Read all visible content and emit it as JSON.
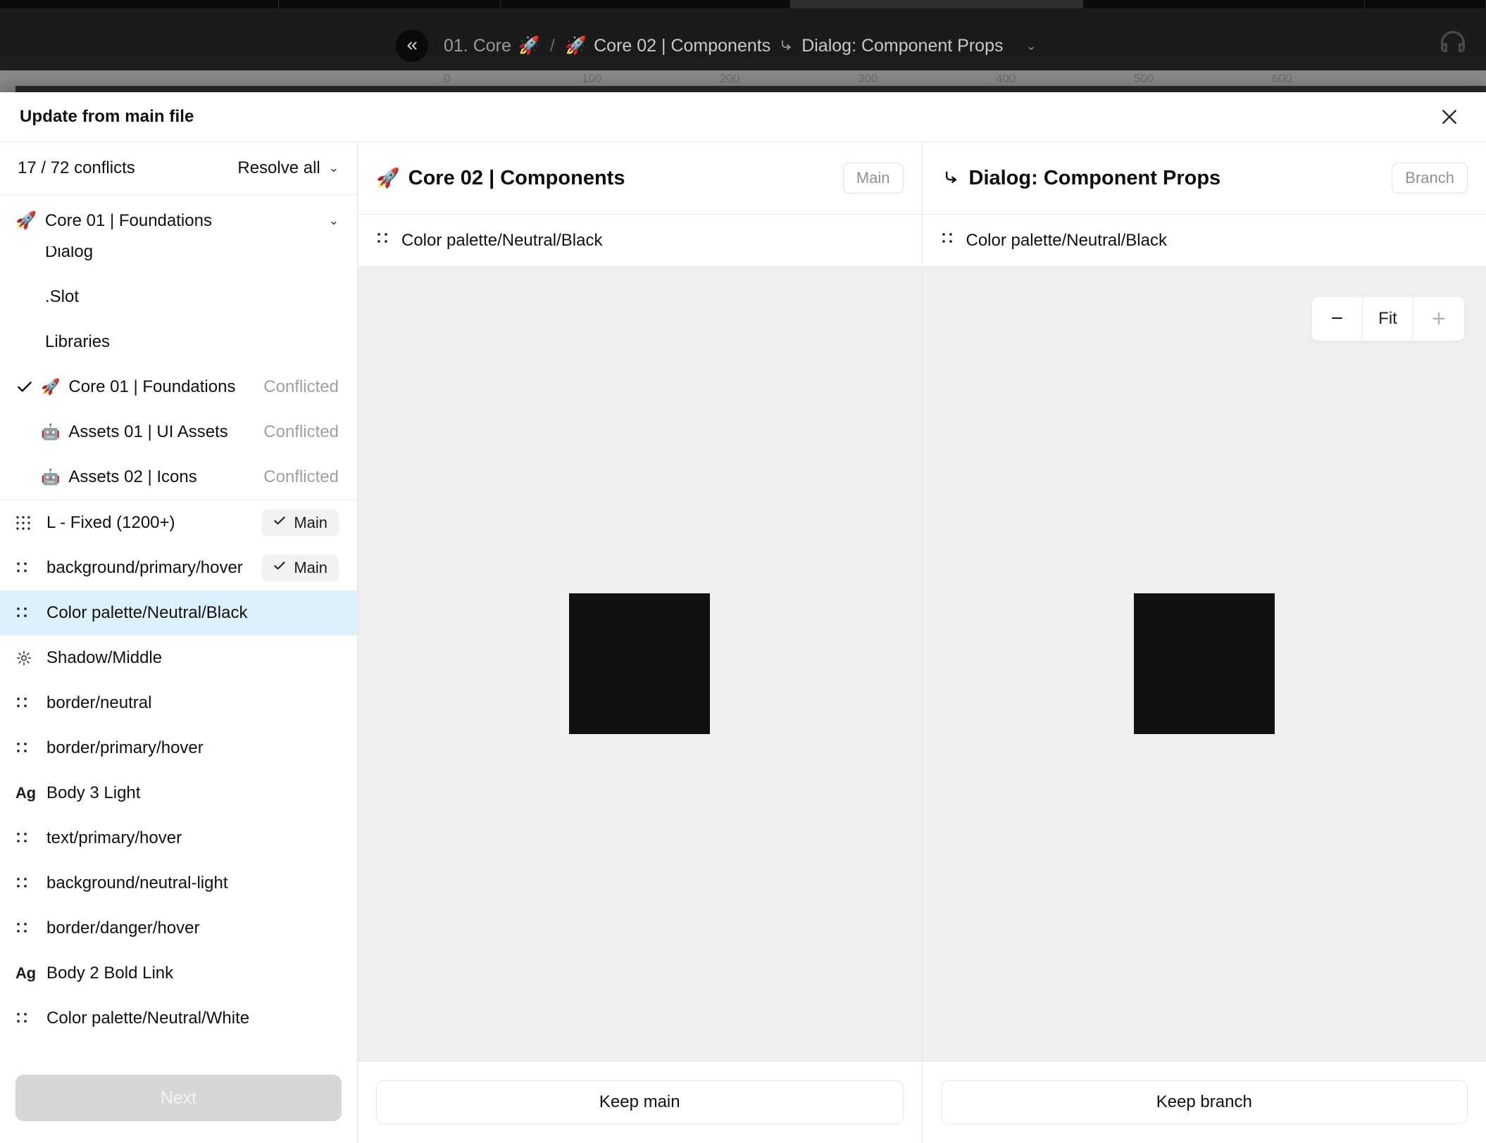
{
  "app": {
    "breadcrumb": {
      "collapse_icon": "chevrons-left-icon",
      "item1": "01. Core",
      "item1_emoji": "🚀",
      "separator": "/",
      "item2_emoji": "🚀",
      "item2": "Core 02 | Components",
      "branch_icon": "branch-icon",
      "item3": "Dialog: Component Props",
      "chevron": "chevron-down-icon",
      "headphones_icon": "headphones-icon"
    },
    "ruler": {
      "ticks": [
        "0",
        "100",
        "200",
        "300",
        "400",
        "500",
        "600"
      ]
    }
  },
  "modal": {
    "title": "Update from main file",
    "close_icon": "close-icon"
  },
  "sidebar": {
    "conflicts_label": "17 / 72 conflicts",
    "resolve_all_label": "Resolve all",
    "resolve_all_chevron": "chevron-down-icon",
    "group": {
      "emoji": "🚀",
      "label": "Core 01 | Foundations",
      "chevron": "chevron-down-icon"
    },
    "top_items": [
      {
        "label": "Dialog",
        "clipped": true
      },
      {
        "label": ".Slot"
      },
      {
        "label": "Libraries"
      }
    ],
    "library_items": [
      {
        "checked": true,
        "emoji": "🚀",
        "label": "Core 01 | Foundations",
        "status": "Conflicted"
      },
      {
        "checked": false,
        "emoji": "🤖",
        "label": "Assets 01 | UI Assets",
        "status": "Conflicted"
      },
      {
        "checked": false,
        "emoji": "🤖",
        "label": "Assets 02 | Icons",
        "status": "Conflicted"
      }
    ],
    "token_items": [
      {
        "icon": "grid-icon",
        "label": "L - Fixed (1200+)",
        "badge": "Main",
        "badge_check": "check-icon",
        "selected": false
      },
      {
        "icon": "variable-icon",
        "label": "background/primary/hover",
        "badge": "Main",
        "badge_check": "check-icon",
        "selected": false
      },
      {
        "icon": "variable-icon",
        "label": "Color palette/Neutral/Black",
        "badge": "",
        "selected": true
      },
      {
        "icon": "effect-icon",
        "label": "Shadow/Middle",
        "badge": "",
        "selected": false
      },
      {
        "icon": "variable-icon",
        "label": "border/neutral",
        "badge": "",
        "selected": false
      },
      {
        "icon": "variable-icon",
        "label": "border/primary/hover",
        "badge": "",
        "selected": false
      },
      {
        "icon": "text-style-icon",
        "label": "Body 3 Light",
        "badge": "",
        "selected": false
      },
      {
        "icon": "variable-icon",
        "label": "text/primary/hover",
        "badge": "",
        "selected": false
      },
      {
        "icon": "variable-icon",
        "label": "background/neutral-light",
        "badge": "",
        "selected": false
      },
      {
        "icon": "variable-icon",
        "label": "border/danger/hover",
        "badge": "",
        "selected": false
      },
      {
        "icon": "text-style-icon",
        "label": "Body 2 Bold Link",
        "badge": "",
        "selected": false
      },
      {
        "icon": "variable-icon",
        "label": "Color palette/Neutral/White",
        "badge": "",
        "selected": false
      }
    ],
    "next_label": "Next"
  },
  "panes": {
    "main": {
      "emoji": "🚀",
      "title": "Core 02 | Components",
      "badge": "Main",
      "item_icon": "variable-icon",
      "item_label": "Color palette/Neutral/Black",
      "swatch_color": "#111111",
      "footer_label": "Keep main"
    },
    "branch": {
      "icon": "branch-icon",
      "title": "Dialog: Component Props",
      "badge": "Branch",
      "item_icon": "variable-icon",
      "item_label": "Color palette/Neutral/Black",
      "swatch_color": "#111111",
      "footer_label": "Keep branch",
      "zoom": {
        "minus": "−",
        "fit": "Fit",
        "plus": "+"
      }
    }
  },
  "colors": {
    "selected_row": "#dcf1fb",
    "canvas": "#efefef",
    "swatch": "#111111"
  }
}
